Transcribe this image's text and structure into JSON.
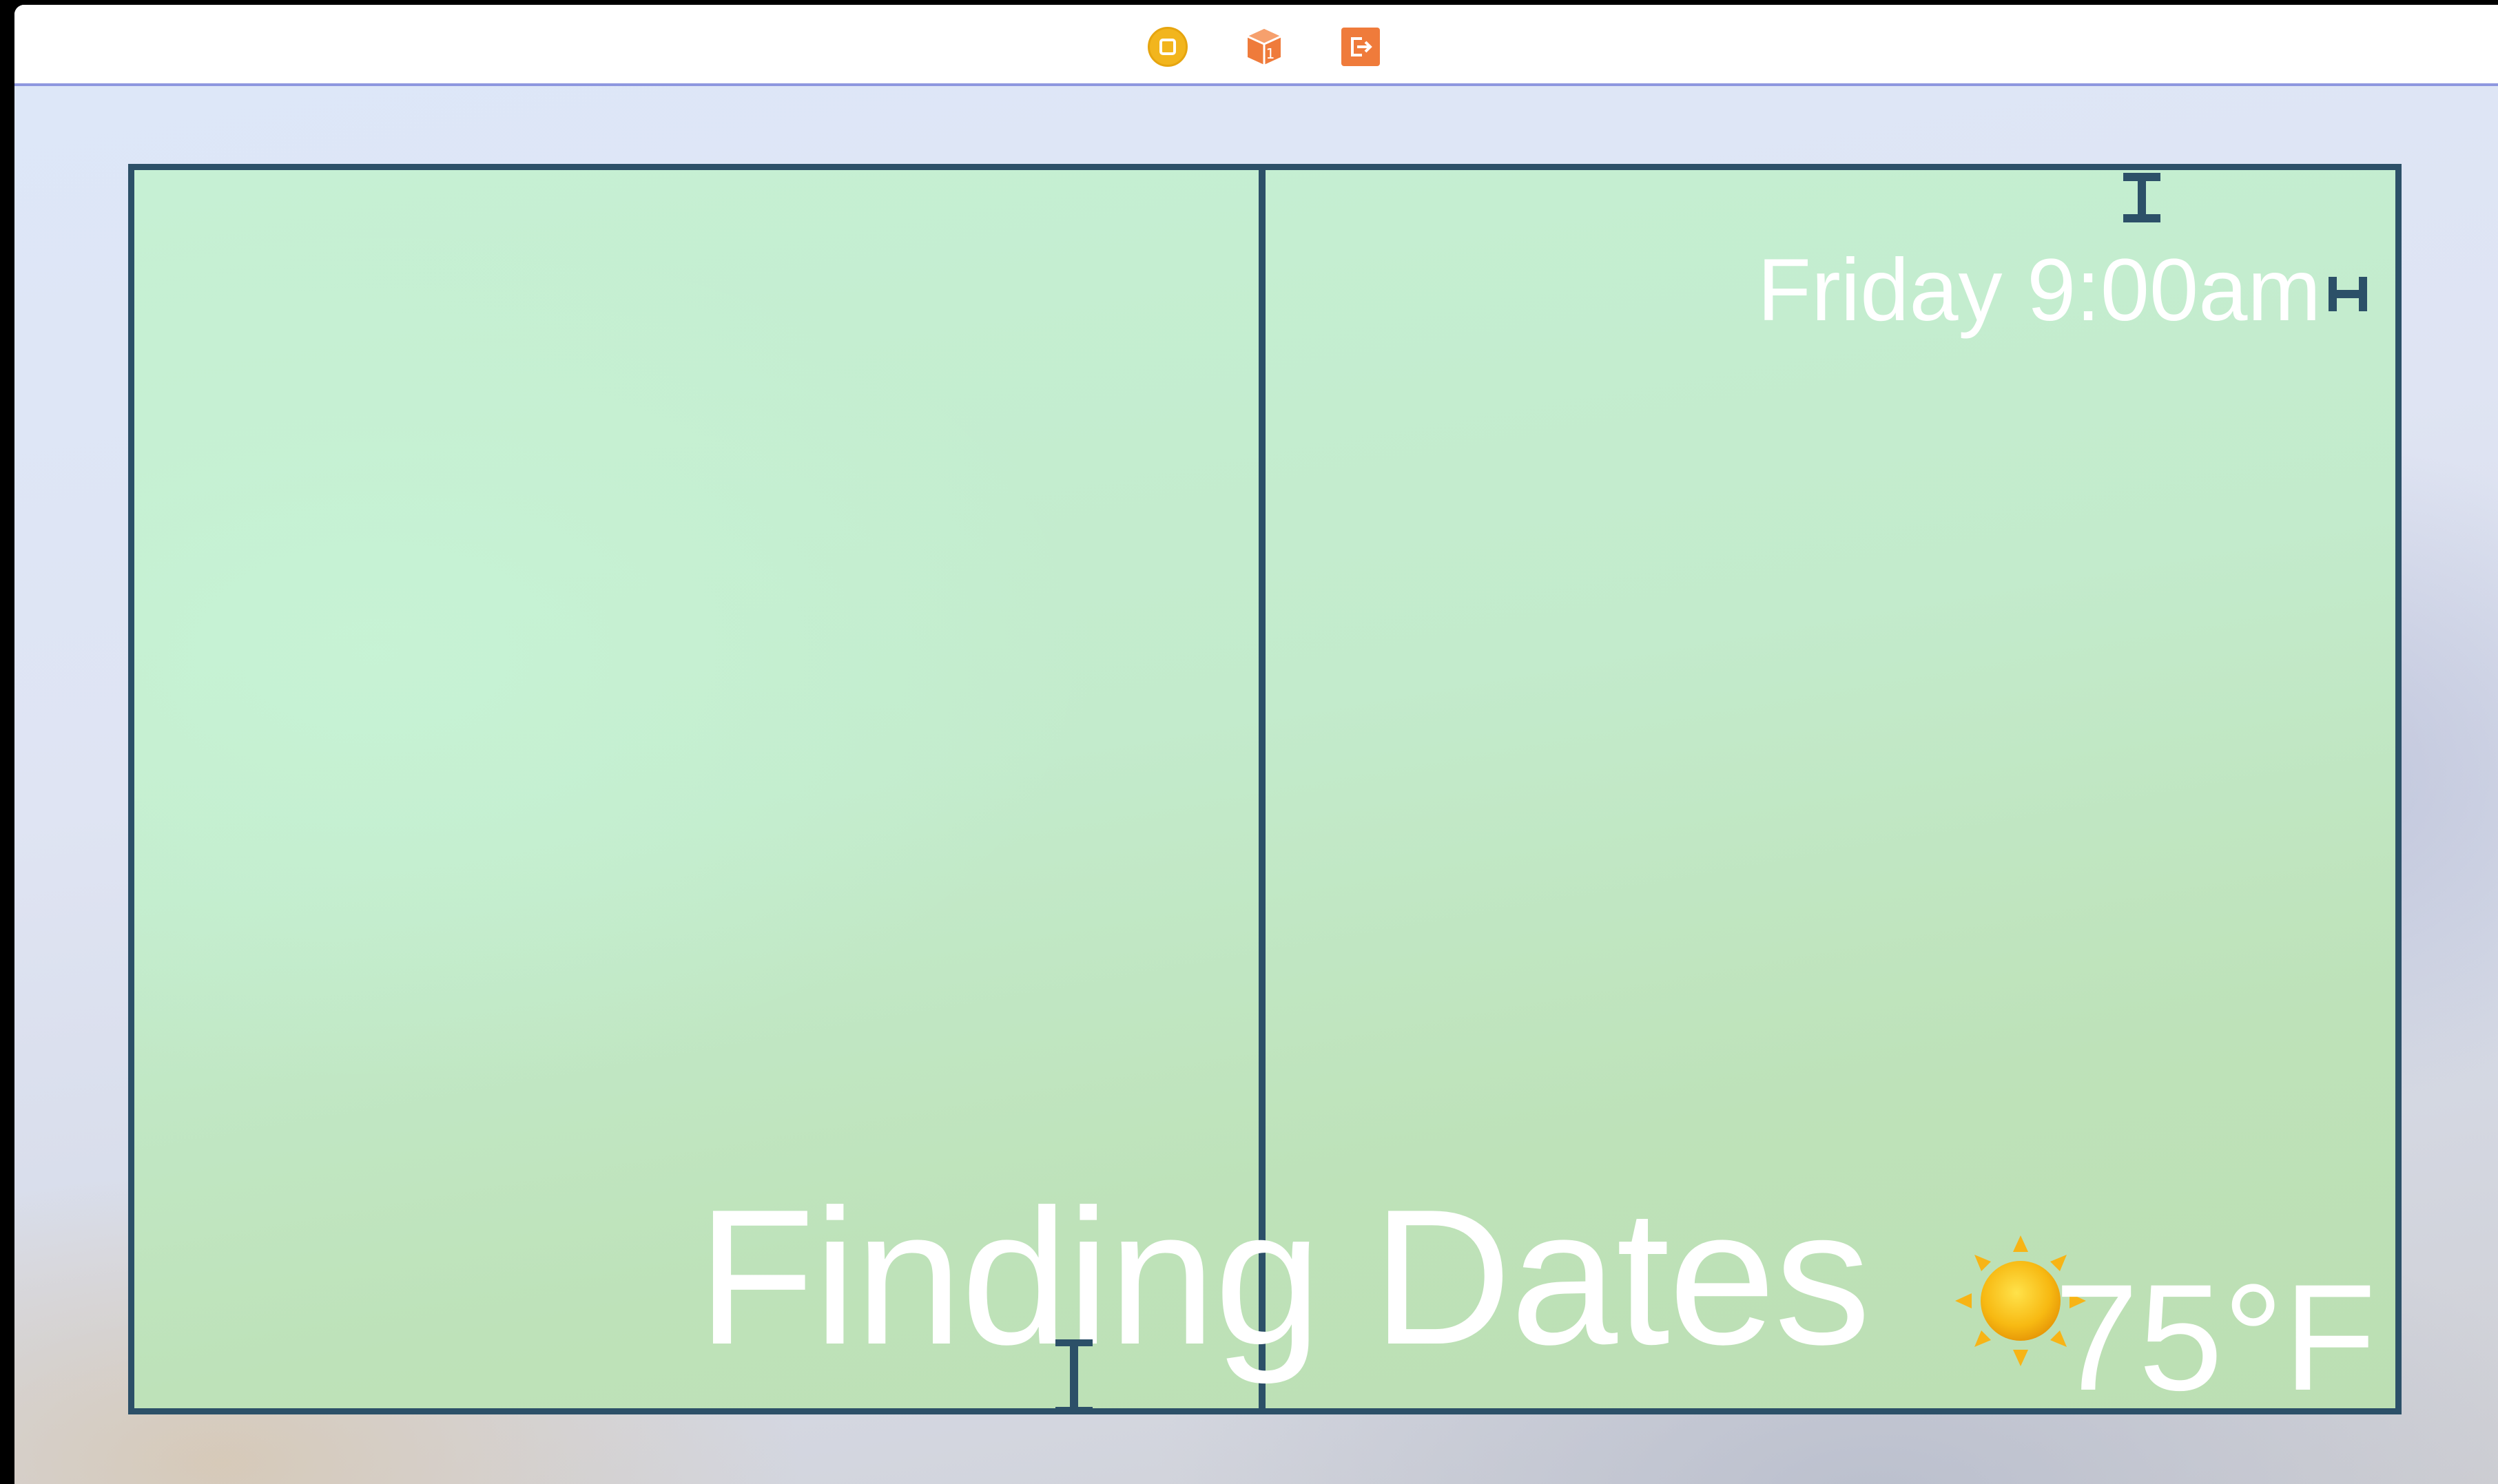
{
  "scene_bar": {
    "icons": [
      "view-controller-icon",
      "first-responder-icon",
      "exit-icon"
    ]
  },
  "main": {
    "date_label": "Friday 9:00am",
    "title_label": "Finding Dates",
    "weather": {
      "icon": "sun-icon",
      "temperature": "75°F"
    }
  },
  "colors": {
    "border": "#2c5068",
    "container_fill": "#c3ebcc",
    "label_text": "#ffffff",
    "scene_bar_underline": "#8e97df"
  }
}
